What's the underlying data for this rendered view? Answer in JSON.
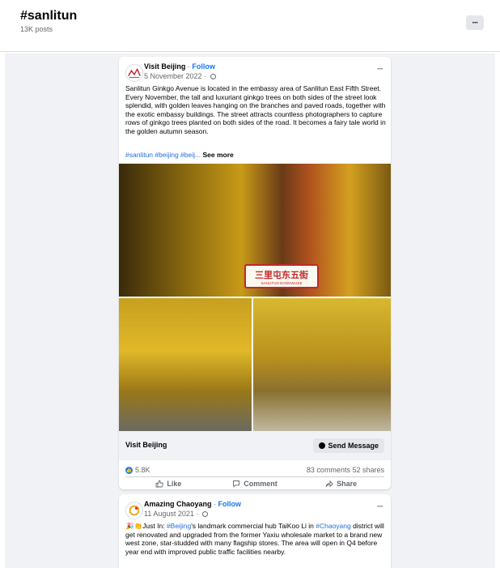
{
  "header": {
    "title": "#sanlitun",
    "post_count": "13K posts",
    "more_label": "···"
  },
  "posts": [
    {
      "page_name": "Visit Beijing",
      "follow_label": "Follow",
      "separator": " · ",
      "date": "5 November 2022 ·",
      "more_label": "···",
      "text": "Sanlitun Ginkgo Avenue is located in the embassy area of Sanlitun East Fifth Street. Every November, the tall and luxuriant ginkgo trees on both sides of the street look splendid, with golden leaves hanging on the branches and paved roads, together with the exotic embassy buildings. The street attracts countless photographers to capture rows of ginkgo trees planted on both sides of the road. It becomes a fairy tale world in the golden autumn season.",
      "tags": "#sanlitun #beijing #beij...",
      "see_more": "See more",
      "sign_main": "三里屯东五街",
      "sign_sub": "SANLITUN DONGWUJIE",
      "cta_name": "Visit Beijing",
      "cta_button": "Send Message",
      "reactions": "5.8K",
      "comments": "83 comments",
      "shares": "52 shares",
      "actions": {
        "like": "Like",
        "comment": "Comment",
        "share": "Share"
      }
    },
    {
      "page_name": "Amazing Chaoyang",
      "follow_label": "Follow",
      "separator": " · ",
      "date": "11 August 2021 ·",
      "more_label": "···",
      "text_prefix": "🎉👏Just In: ",
      "link1": "#Beijing",
      "text_mid": "'s landmark commercial hub TaiKoo Li in ",
      "link2": "#Chaoyang",
      "text_rest": " district will get renovated and upgraded from the former Yaxiu wholesale market to a brand new west zone, star-studded with many flagship stores. The area will open in Q4 before year end with improved public traffic facilities nearby."
    }
  ],
  "colors": {
    "accent": "#1877f2",
    "link": "#216fdb",
    "feed_bg": "#f0f2f5"
  }
}
